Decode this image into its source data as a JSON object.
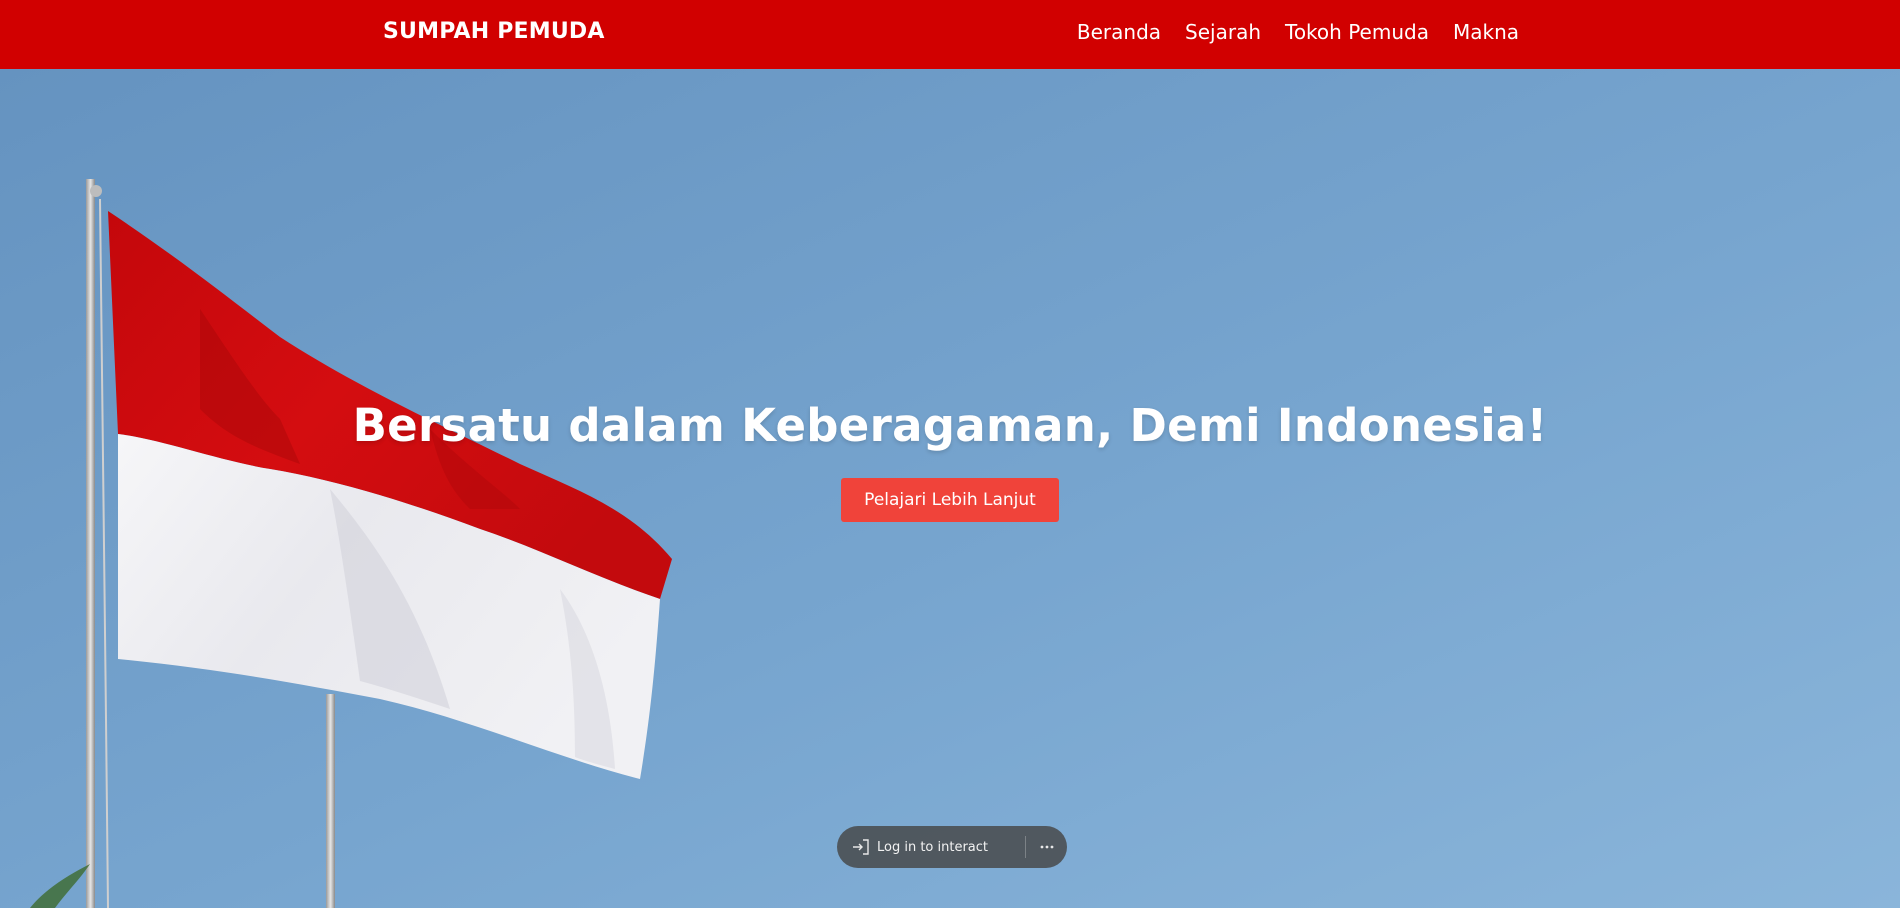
{
  "nav": {
    "brand": "SUMPAH PEMUDA",
    "links": [
      {
        "label": "Beranda"
      },
      {
        "label": "Sejarah"
      },
      {
        "label": "Tokoh Pemuda"
      },
      {
        "label": "Makna"
      }
    ]
  },
  "hero": {
    "title": "Bersatu dalam Keberagaman, Demi Indonesia!",
    "button_label": "Pelajari Lebih Lanjut",
    "image_icon": "indonesian-flag-photo"
  },
  "overlay": {
    "login_label": "Log in to interact",
    "login_icon": "sign-in-icon",
    "more_icon": "more-horizontal-icon"
  },
  "colors": {
    "navbar": "#d10000",
    "button": "#f0433a",
    "flag_red": "#d40d10",
    "flag_white": "#f4f4f6",
    "sky": "#74a2cc"
  }
}
